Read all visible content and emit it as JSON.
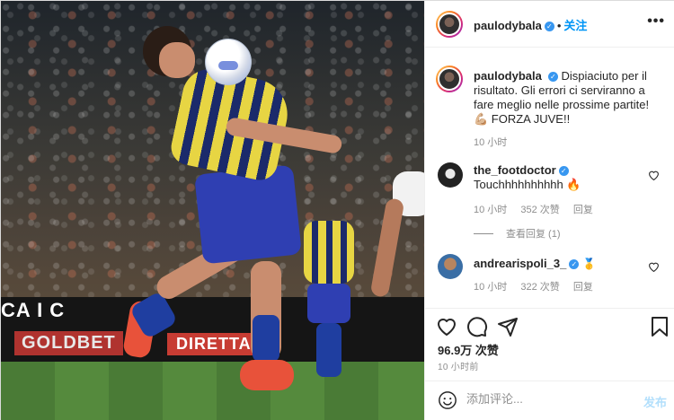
{
  "post": {
    "author": "paulodybala",
    "follow_label": "关注",
    "more_label": "•••"
  },
  "photo": {
    "ad_text_1": "CA  I  C",
    "ad_text_2": "GOLDBET",
    "ad_text_3": "DIRETTA"
  },
  "caption": {
    "username": "paulodybala",
    "text": "Dispiaciuto per il risultato. Gli errori ci serviranno a fare meglio nelle prossime partite! 💪🏼 FORZA JUVE!!",
    "time": "10 小时"
  },
  "comments": [
    {
      "username": "the_footdoctor",
      "text": "Touchhhhhhhhhh 🔥",
      "time": "10 小时",
      "likes": "352 次赞",
      "reply_label": "回复",
      "view_replies": "查看回复 (1)"
    },
    {
      "username": "andrearispoli_3_",
      "text": "",
      "emoji_badge": "🥇",
      "time": "10 小时",
      "likes": "322 次赞",
      "reply_label": "回复"
    }
  ],
  "actions": {
    "likes": "96.9万 次赞",
    "time": "10 小时前",
    "comment_placeholder": "添加评论...",
    "post_label": "发布"
  },
  "colors": {
    "link_blue": "#0095f6",
    "verified_blue": "#3897f0",
    "muted_text": "#8e8e8e",
    "post_disabled": "#b2dffc"
  },
  "icons": {
    "like": "heart-icon",
    "comment": "comment-icon",
    "share": "paper-plane-icon",
    "save": "bookmark-icon",
    "emoji": "smiley-icon",
    "verified": "verified-badge-icon",
    "more": "more-options-icon"
  }
}
